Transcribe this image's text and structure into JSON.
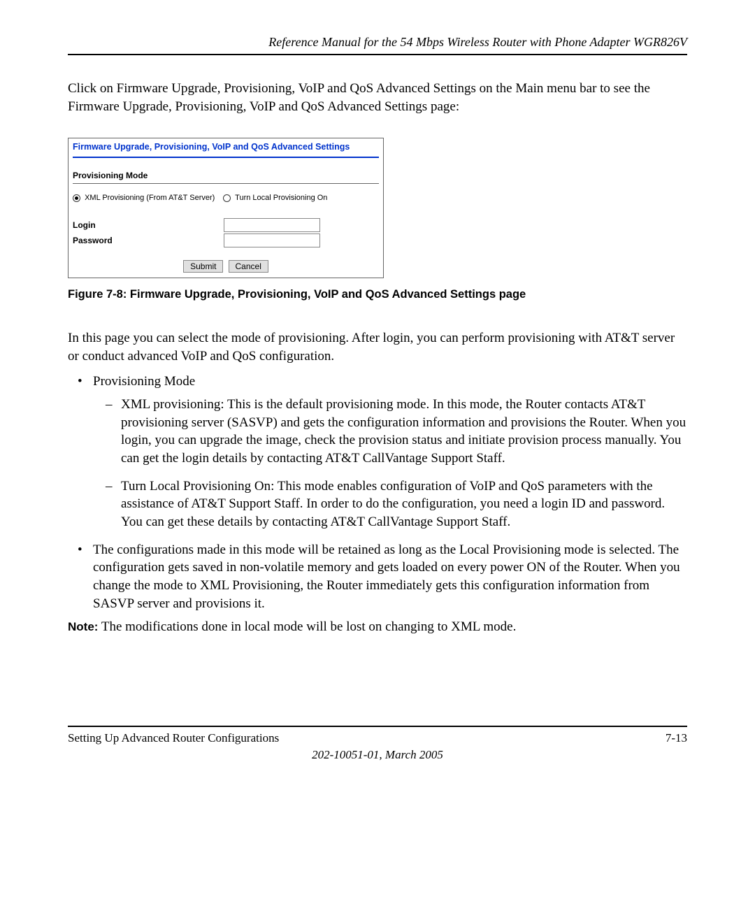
{
  "header": "Reference Manual for the 54 Mbps Wireless Router with Phone Adapter WGR826V",
  "intro": "Click on Firmware Upgrade, Provisioning, VoIP and QoS Advanced Settings on the Main menu bar to see the Firmware Upgrade, Provisioning, VoIP and QoS Advanced Settings page:",
  "settings": {
    "title": "Firmware Upgrade, Provisioning, VoIP and QoS Advanced Settings",
    "section_label": "Provisioning Mode",
    "radio1": "XML Provisioning (From AT&T Server)",
    "radio2": "Turn Local Provisioning On",
    "login_label": "Login",
    "password_label": "Password",
    "submit": "Submit",
    "cancel": "Cancel"
  },
  "figure_caption": "Figure 7-8:  Firmware Upgrade, Provisioning, VoIP and QoS Advanced Settings page",
  "para2": "In this page you can select the mode of provisioning. After login, you can perform provisioning with AT&T server or conduct advanced VoIP and QoS configuration.",
  "bullets": {
    "b1": "Provisioning Mode",
    "d1": "XML provisioning: This is the default provisioning mode. In this mode, the Router contacts AT&T provisioning server (SASVP) and gets the configuration information and provisions the Router. When you login, you can upgrade the image, check the provision status and initiate provision process manually. You can get the login details by contacting AT&T CallVantage Support Staff.",
    "d2": "Turn Local Provisioning On: This mode enables configuration of VoIP and QoS parameters with the assistance of AT&T Support Staff. In order to do the configuration, you need a login ID and password. You can get these details by contacting AT&T CallVantage Support Staff.",
    "b2": "The configurations made in this mode will be retained as long as the Local Provisioning mode is selected. The configuration gets saved in non-volatile memory and gets loaded on every power ON of the Router. When you change the mode to XML Provisioning, the Router immediately gets this configuration information from SASVP server and provisions it."
  },
  "note_label": "Note:",
  "note_text": " The modifications done in local mode will be lost on changing to XML mode.",
  "footer": {
    "left": "Setting Up Advanced Router Configurations",
    "right": "7-13",
    "docid": "202-10051-01, March 2005"
  }
}
